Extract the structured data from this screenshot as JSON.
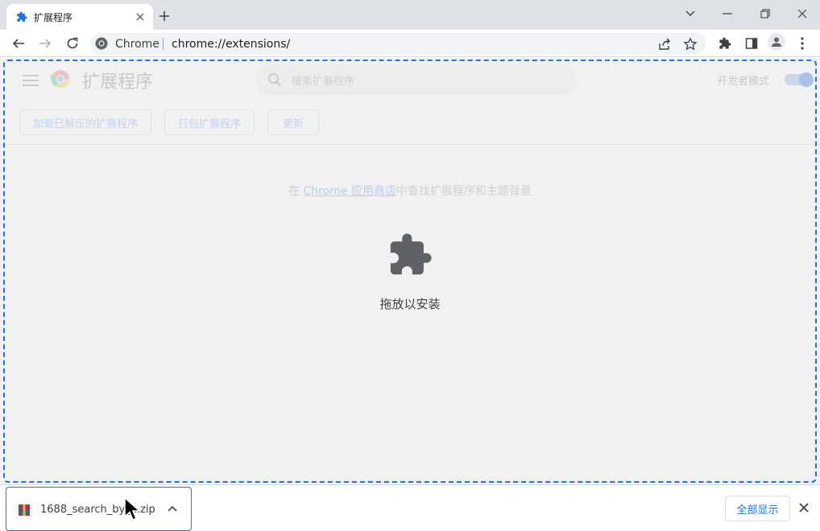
{
  "browser": {
    "tab": {
      "title": "扩展程序"
    },
    "omnibox": {
      "site": "Chrome",
      "url": "chrome://extensions/"
    }
  },
  "page": {
    "title": "扩展程序",
    "search_placeholder": "搜索扩展程序",
    "developer_mode_label": "开发者模式",
    "developer_mode": true,
    "buttons": {
      "load_unpacked": "加载已解压的扩展程序",
      "pack": "打包扩展程序",
      "update": "更新"
    },
    "store_line": {
      "prefix": "在 ",
      "link": "Chrome 应用商店",
      "suffix": "中查找扩展程序和主题背景"
    },
    "drop_label": "拖放以安装"
  },
  "downloads": {
    "file_name": "1688_search_by_...zip",
    "show_all": "全部显示"
  },
  "colors": {
    "accent": "#1a73e8",
    "tabstrip": "#dee1e6",
    "page_bg": "#f1f1f1"
  }
}
